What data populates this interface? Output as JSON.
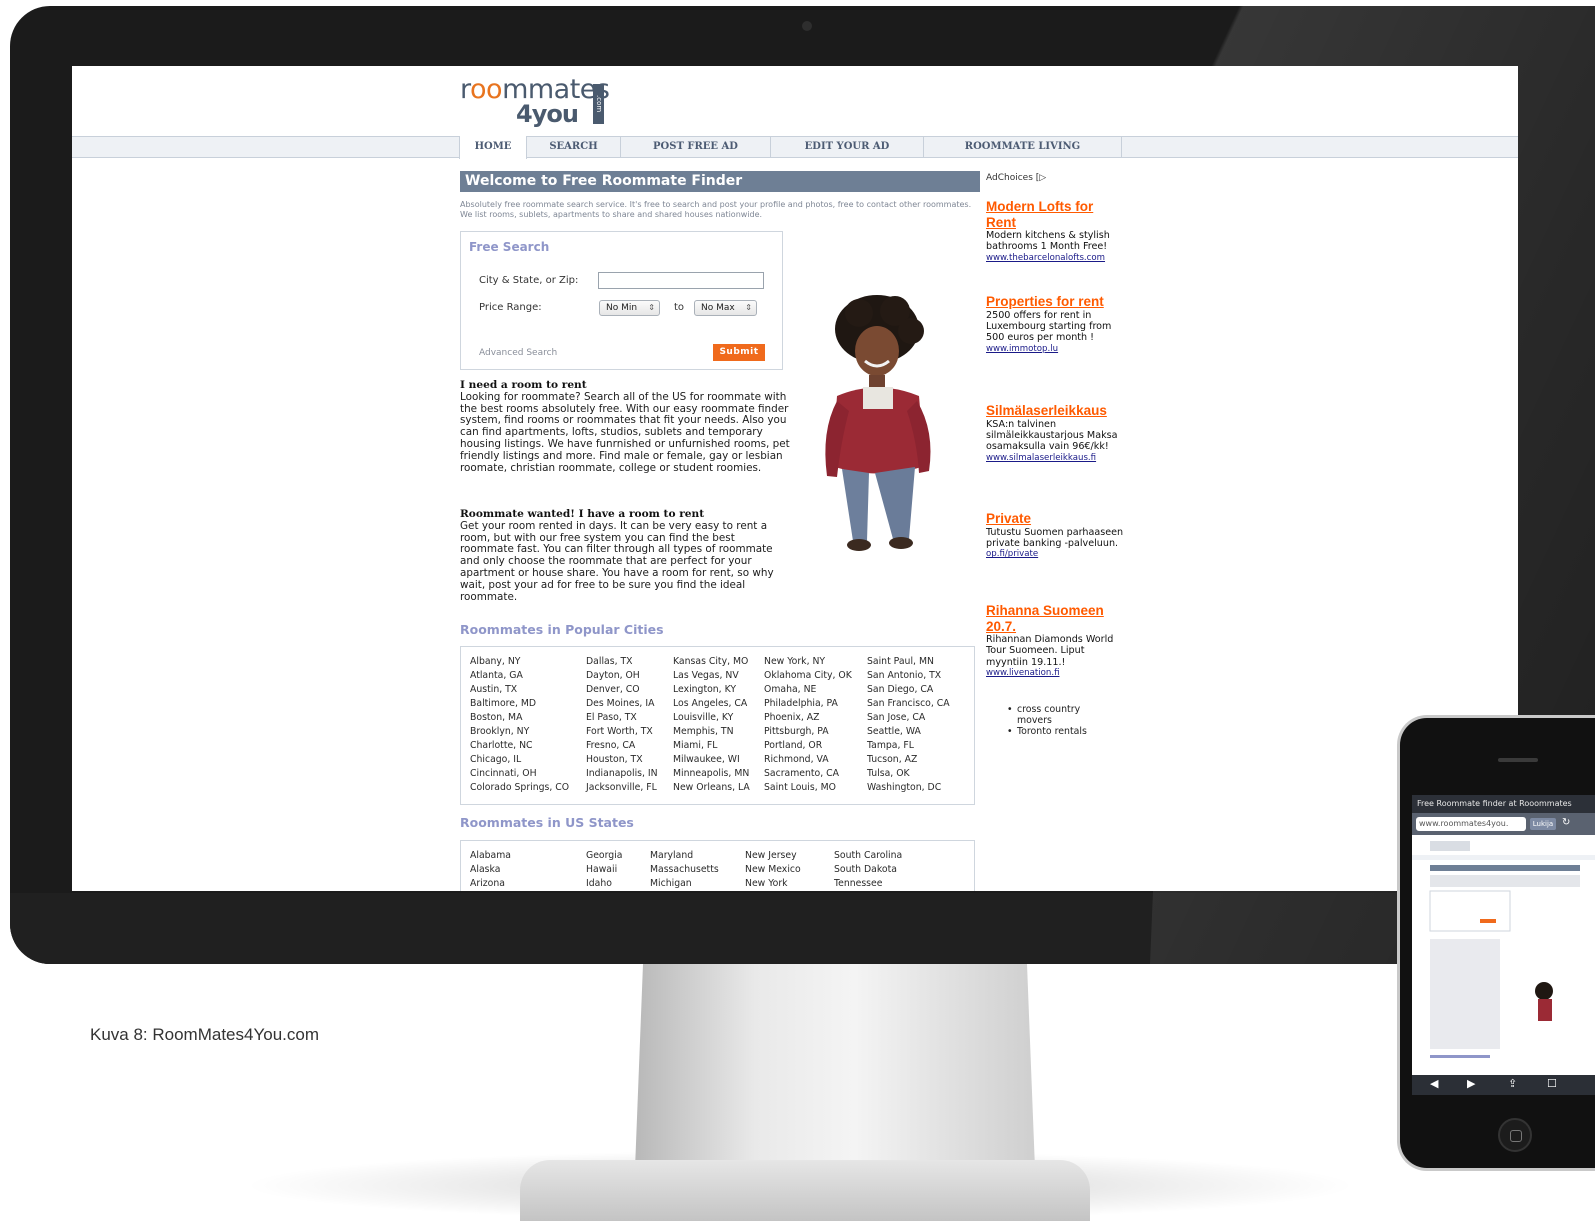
{
  "caption": "Kuva 8: RoomMates4You.com",
  "logo": {
    "top_a": "r",
    "top_oo": "oo",
    "top_b": "mmates",
    "bottom": "4you",
    "com": ".com"
  },
  "nav": [
    "HOME",
    "SEARCH",
    "POST FREE AD",
    "EDIT YOUR AD",
    "ROOMMATE LIVING"
  ],
  "welcome": {
    "title": "Welcome to Free Roommate Finder",
    "intro": "Absolutely free roommate search service. It's free to search and post your profile and photos, free to contact other roommates. We list rooms, sublets, apartments to share and shared houses nationwide."
  },
  "search": {
    "title": "Free Search",
    "city_label": "City & State, or Zip:",
    "city_value": "",
    "price_label": "Price Range:",
    "min_value": "No Min",
    "to": "to",
    "max_value": "No Max",
    "advanced": "Advanced Search",
    "submit": "Submit"
  },
  "need_room": {
    "heading": "I need a room to rent",
    "body": "Looking for roommate? Search all of the US for roommate with the best rooms absolutely free. With our easy roommate finder system, find rooms or roommates that fit your needs. Also you can find apartments, lofts, studios, sublets and temporary housing listings. We have funrnished or unfurnished rooms, pet friendly listings and more. Find male or female, gay or lesbian roomate, christian roommate, college or student roomies."
  },
  "have_room": {
    "heading": "Roommate wanted! I have a room to rent",
    "body": "Get your room rented in days. It can be very easy to rent a room, but with our free system you can find the best roommate fast. You can filter through all types of roommate and only choose the roommate that are perfect for your apartment or house share. You have a room for rent, so why wait, post your ad for free to be sure you find the ideal roommate."
  },
  "cities": {
    "heading": "Roommates in Popular Cities",
    "columns": [
      [
        "Albany, NY",
        "Atlanta, GA",
        "Austin, TX",
        "Baltimore, MD",
        "Boston, MA",
        "Brooklyn, NY",
        "Charlotte, NC",
        "Chicago, IL",
        "Cincinnati, OH",
        "Colorado Springs, CO"
      ],
      [
        "Dallas, TX",
        "Dayton, OH",
        "Denver, CO",
        "Des Moines, IA",
        "El Paso, TX",
        "Fort Worth, TX",
        "Fresno, CA",
        "Houston, TX",
        "Indianapolis, IN",
        "Jacksonville, FL"
      ],
      [
        "Kansas City, MO",
        "Las Vegas, NV",
        "Lexington, KY",
        "Los Angeles, CA",
        "Louisville, KY",
        "Memphis, TN",
        "Miami, FL",
        "Milwaukee, WI",
        "Minneapolis, MN",
        "New Orleans, LA"
      ],
      [
        "New York, NY",
        "Oklahoma City, OK",
        "Omaha, NE",
        "Philadelphia, PA",
        "Phoenix, AZ",
        "Pittsburgh, PA",
        "Portland, OR",
        "Richmond, VA",
        "Sacramento, CA",
        "Saint Louis, MO"
      ],
      [
        "Saint Paul, MN",
        "San Antonio, TX",
        "San Diego, CA",
        "San Francisco, CA",
        "San Jose, CA",
        "Seattle, WA",
        "Tampa, FL",
        "Tucson, AZ",
        "Tulsa, OK",
        "Washington, DC"
      ]
    ]
  },
  "states": {
    "heading": "Roommates in US States",
    "columns": [
      [
        "Alabama",
        "Alaska",
        "Arizona"
      ],
      [
        "Georgia",
        "Hawaii",
        "Idaho"
      ],
      [
        "Maryland",
        "Massachusetts",
        "Michigan"
      ],
      [
        "New Jersey",
        "New Mexico",
        "New York"
      ],
      [
        "South Carolina",
        "South Dakota",
        "Tennessee"
      ]
    ]
  },
  "ads": {
    "adchoices": "AdChoices [▷",
    "items": [
      {
        "title": "Modern Lofts for Rent",
        "body": "Modern kitchens & stylish bathrooms 1 Month Free!",
        "url": "www.thebarcelonalofts.com"
      },
      {
        "title": "Properties for rent",
        "body": "2500 offers for rent in Luxembourg starting from 500 euros per month !",
        "url": "www.immotop.lu"
      },
      {
        "title": "Silmälaserleikkaus",
        "body": "KSA:n talvinen silmäleikkaustarjous Maksa osamaksulla vain 96€/kk!",
        "url": "www.silmalaserleikkaus.fi"
      },
      {
        "title": "Private",
        "body": "Tutustu Suomen parhaaseen private banking -palveluun.",
        "url": "op.fi/private"
      },
      {
        "title": "Rihanna Suomeen 20.7.",
        "body": "Rihannan Diamonds World Tour Suomeen. Liput myyntiin 19.11.!",
        "url": "www.livenation.fi"
      }
    ],
    "links": [
      "cross country movers",
      "Toronto rentals"
    ]
  },
  "phone": {
    "title": "Free Roommate finder at Rooommates",
    "url": "www.roommates4you.",
    "go": "Lukija"
  },
  "colors": {
    "accent_orange": "#f06a1c",
    "nav_text": "#4c5b73",
    "heading_purple": "#8f96c9",
    "title_bar": "#6e7f95"
  }
}
